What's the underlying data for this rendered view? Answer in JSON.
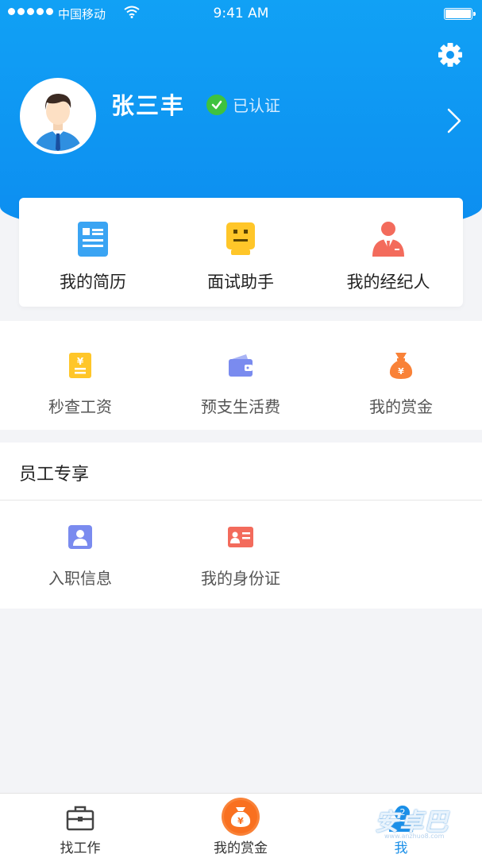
{
  "status_bar": {
    "carrier": "中国移动",
    "time": "9:41 AM"
  },
  "profile": {
    "name": "张三丰",
    "verified_label": "已认证"
  },
  "quick_actions": [
    {
      "label": "我的简历",
      "icon": "resume-icon"
    },
    {
      "label": "面试助手",
      "icon": "interview-assistant-icon"
    },
    {
      "label": "我的经纪人",
      "icon": "agent-icon"
    }
  ],
  "finance": [
    {
      "label": "秒查工资",
      "icon": "salary-icon"
    },
    {
      "label": "预支生活费",
      "icon": "wallet-icon"
    },
    {
      "label": "我的赏金",
      "icon": "money-bag-icon"
    }
  ],
  "employee": {
    "title": "员工专享",
    "items": [
      {
        "label": "入职信息",
        "icon": "onboarding-info-icon"
      },
      {
        "label": "我的身份证",
        "icon": "id-card-icon"
      }
    ]
  },
  "tabbar": {
    "items": [
      {
        "label": "找工作",
        "icon": "briefcase-icon"
      },
      {
        "label": "我的赏金",
        "icon": "bounty-coin-icon"
      },
      {
        "label": "我",
        "icon": "profile-icon",
        "active": true
      }
    ],
    "badge": "2"
  },
  "watermark": {
    "text": "安卓巴",
    "sub": "www.anzhuo8.com"
  },
  "colors": {
    "header": "#0c8df0",
    "accent": "#1a8fe8",
    "verified": "#3fc23f",
    "orange": "#f98238",
    "yellow": "#ffc629"
  }
}
